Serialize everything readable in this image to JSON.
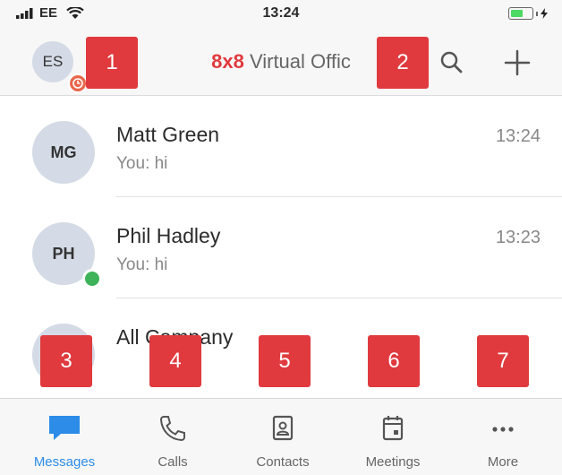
{
  "status_bar": {
    "carrier": "EE",
    "time": "13:24"
  },
  "header": {
    "user_initials": "ES",
    "title_brand": "8x8",
    "title_rest": " Virtual Offic"
  },
  "conversations": [
    {
      "initials": "MG",
      "name": "Matt Green",
      "preview": "You: hi",
      "time": "13:24",
      "presence": "none"
    },
    {
      "initials": "PH",
      "name": "Phil Hadley",
      "preview": "You: hi",
      "time": "13:23",
      "presence": "online"
    },
    {
      "initials": "",
      "name": "All Company",
      "preview": "",
      "time": "",
      "presence": "none"
    }
  ],
  "tabs": [
    {
      "label": "Messages",
      "icon": "chat-bubble-icon",
      "active": true
    },
    {
      "label": "Calls",
      "icon": "phone-icon",
      "active": false
    },
    {
      "label": "Contacts",
      "icon": "contact-card-icon",
      "active": false
    },
    {
      "label": "Meetings",
      "icon": "calendar-icon",
      "active": false
    },
    {
      "label": "More",
      "icon": "more-dots-icon",
      "active": false
    }
  ],
  "callouts": [
    "1",
    "2",
    "3",
    "4",
    "5",
    "6",
    "7"
  ],
  "colors": {
    "brand_red": "#e03a3e",
    "active_blue": "#2c8ce8",
    "online_green": "#3eb35a",
    "busy_orange": "#e9674b"
  }
}
